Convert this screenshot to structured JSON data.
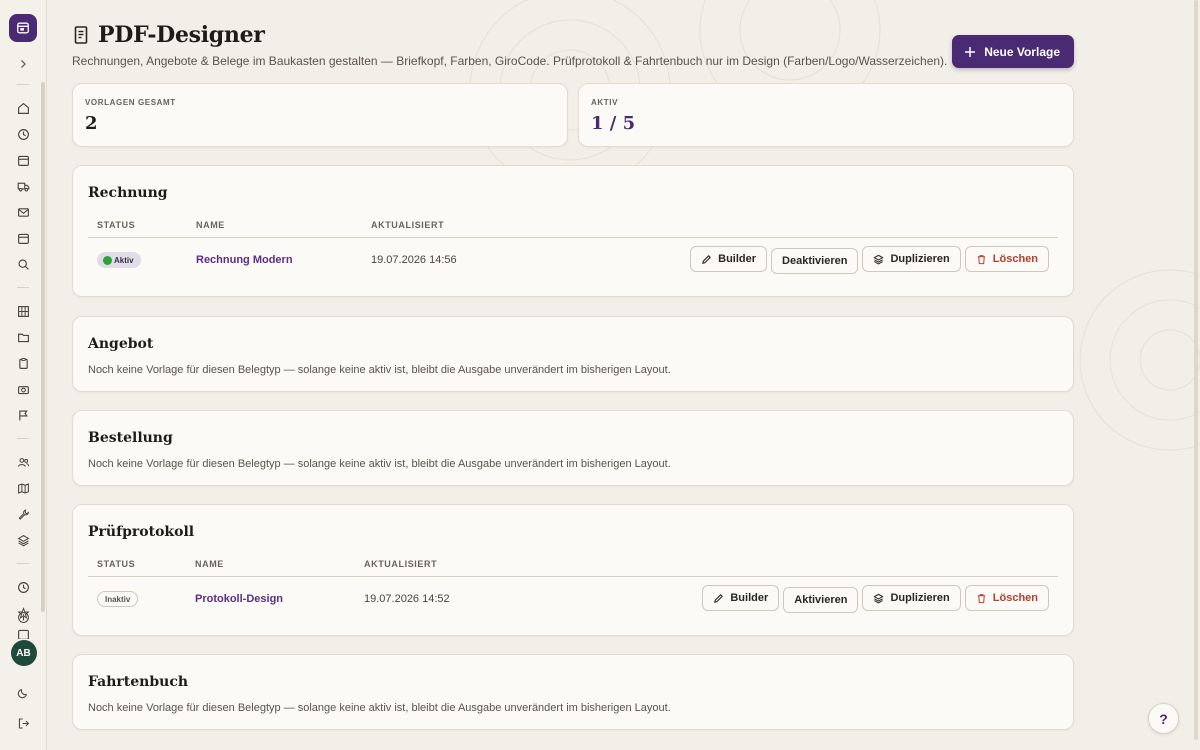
{
  "header": {
    "title": "PDF-Designer",
    "subtitle": "Rechnungen, Angebote & Belege im Baukasten gestalten — Briefkopf, Farben, GiroCode. Prüfprotokoll & Fahrtenbuch nur im Design (Farben/Logo/Wasserzeichen).",
    "new_button": "Neue Vorlage"
  },
  "stats": {
    "total_label": "VORLAGEN GESAMT",
    "total_value": "2",
    "active_label": "AKTIV",
    "active_value": "1 / 5"
  },
  "columns": {
    "status": "STATUS",
    "name": "NAME",
    "updated": "AKTUALISIERT"
  },
  "sections": {
    "rechnung": {
      "title": "Rechnung",
      "row": {
        "status": "Aktiv",
        "name": "Rechnung Modern",
        "updated": "19.07.2026 14:56",
        "builder": "Builder",
        "toggle": "Deaktivieren",
        "duplicate": "Duplizieren",
        "delete": "Löschen"
      }
    },
    "angebot": {
      "title": "Angebot",
      "empty": "Noch keine Vorlage für diesen Belegtyp — solange keine aktiv ist, bleibt die Ausgabe unverändert im bisherigen Layout."
    },
    "bestellung": {
      "title": "Bestellung",
      "empty": "Noch keine Vorlage für diesen Belegtyp — solange keine aktiv ist, bleibt die Ausgabe unverändert im bisherigen Layout."
    },
    "pruefprotokoll": {
      "title": "Prüfprotokoll",
      "row": {
        "status": "Inaktiv",
        "name": "Protokoll-Design",
        "updated": "19.07.2026 14:52",
        "builder": "Builder",
        "toggle": "Aktivieren",
        "duplicate": "Duplizieren",
        "delete": "Löschen"
      }
    },
    "fahrtenbuch": {
      "title": "Fahrtenbuch",
      "empty": "Noch keine Vorlage für diesen Belegtyp — solange keine aktiv ist, bleibt die Ausgabe unverändert im bisherigen Layout."
    }
  },
  "user": {
    "initials": "AB"
  },
  "help": {
    "label": "?"
  },
  "colors": {
    "accent": "#4a2a73",
    "link": "#5a2d8a",
    "danger": "#b5402e",
    "active_dot": "#2fa13a",
    "avatar": "#1f4a3b"
  }
}
